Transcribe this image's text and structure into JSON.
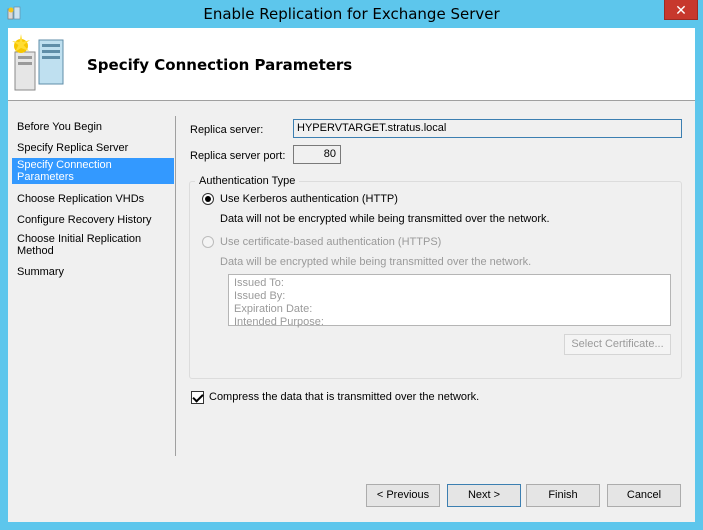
{
  "window": {
    "title": "Enable Replication for Exchange Server",
    "close_glyph": "✕"
  },
  "header": {
    "title": "Specify Connection Parameters",
    "icon": "server-wizard-icon"
  },
  "nav": {
    "items": [
      {
        "label": "Before You Begin",
        "selected": false
      },
      {
        "label": "Specify Replica Server",
        "selected": false
      },
      {
        "label": "Specify Connection Parameters",
        "selected": true
      },
      {
        "label": "Choose Replication VHDs",
        "selected": false
      },
      {
        "label": "Configure Recovery History",
        "selected": false
      },
      {
        "label": "Choose Initial Replication Method",
        "selected": false
      },
      {
        "label": "Summary",
        "selected": false
      }
    ]
  },
  "form": {
    "replica_server_label": "Replica server:",
    "replica_server_value": "HYPERVTARGET.stratus.local",
    "replica_port_label": "Replica server port:",
    "replica_port_value": "80",
    "auth_group_title": "Authentication Type",
    "kerberos_label": "Use Kerberos authentication (HTTP)",
    "kerberos_note": "Data will not be encrypted while being transmitted over the network.",
    "kerberos_selected": true,
    "cert_label": "Use certificate-based authentication (HTTPS)",
    "cert_note": "Data will be encrypted while being transmitted over the network.",
    "cert_fields": [
      "Issued To:",
      "Issued By:",
      "Expiration Date:",
      "Intended Purpose:"
    ],
    "select_certificate_label": "Select Certificate...",
    "compress_label": "Compress the data that is transmitted over the network.",
    "compress_checked": true
  },
  "buttons": {
    "previous": "< Previous",
    "next": "Next >",
    "finish": "Finish",
    "cancel": "Cancel"
  },
  "colors": {
    "titlebar": "#5dc6ec",
    "selected": "#3399ff",
    "close": "#c7382d"
  }
}
